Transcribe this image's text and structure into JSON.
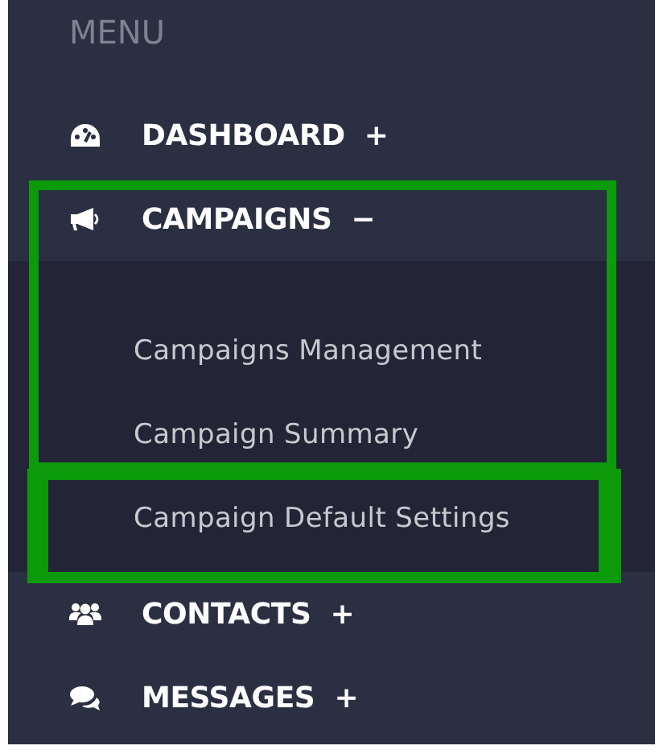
{
  "sidebar": {
    "heading": "MENU",
    "items": [
      {
        "label": "DASHBOARD",
        "toggle": "+"
      },
      {
        "label": "CAMPAIGNS",
        "toggle": "−",
        "children": [
          {
            "label": "Campaigns Management"
          },
          {
            "label": "Campaign Summary"
          },
          {
            "label": "Campaign Default Settings"
          }
        ]
      },
      {
        "label": "CONTACTS",
        "toggle": "+"
      },
      {
        "label": "MESSAGES",
        "toggle": "+"
      }
    ]
  }
}
